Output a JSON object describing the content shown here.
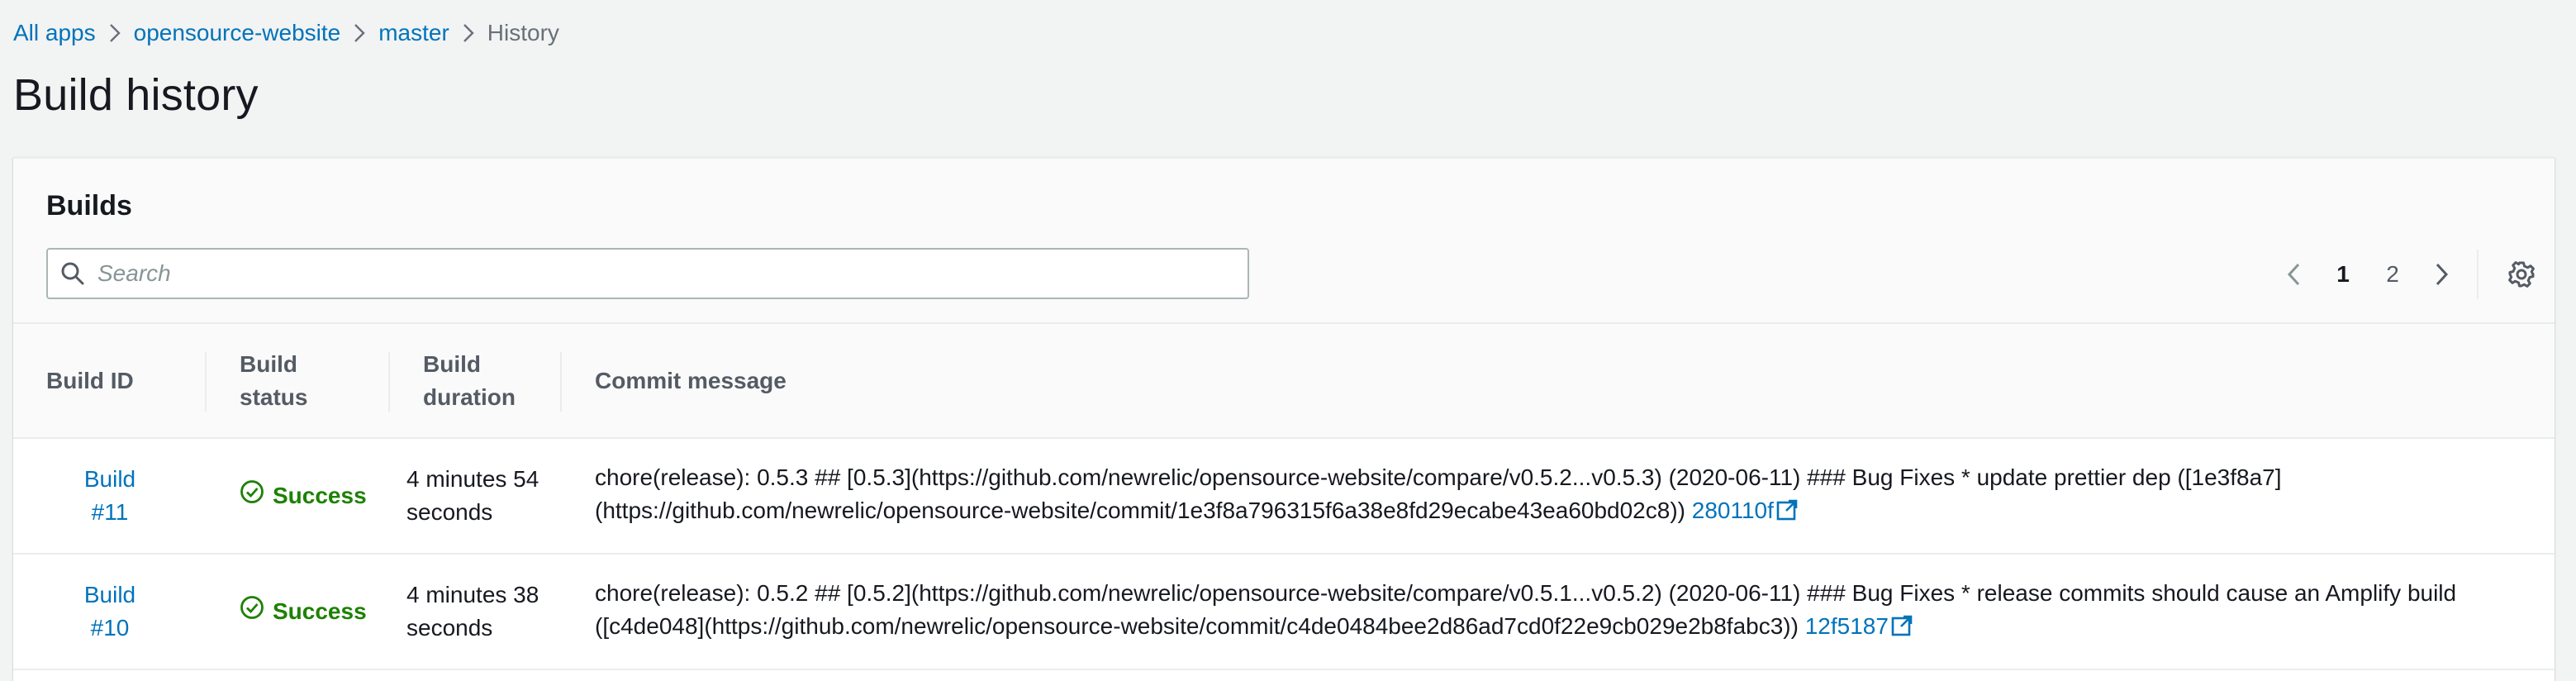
{
  "breadcrumb": {
    "items": [
      "All apps",
      "opensource-website",
      "master"
    ],
    "current": "History"
  },
  "page_title": "Build history",
  "builds_panel": {
    "title": "Builds",
    "search_placeholder": "Search",
    "pagination": {
      "pages": [
        "1",
        "2"
      ],
      "current_page": "1"
    }
  },
  "table": {
    "columns": [
      "Build ID",
      "Build status",
      "Build duration",
      "Commit message"
    ],
    "rows": [
      {
        "build_id": "Build #11",
        "status": "Success",
        "duration": "4 minutes 54 seconds",
        "commit_message": "chore(release): 0.5.3 ## [0.5.3](https://github.com/newrelic/opensource-website/compare/v0.5.2...v0.5.3) (2020-06-11) ### Bug Fixes * update prettier dep ([1e3f8a7](https://github.com/newrelic/opensource-website/commit/1e3f8a796315f6a38e8fd29ecabe43ea60bd02c8))",
        "commit_link": "280110f"
      },
      {
        "build_id": "Build #10",
        "status": "Success",
        "duration": "4 minutes 38 seconds",
        "commit_message": "chore(release): 0.5.2 ## [0.5.2](https://github.com/newrelic/opensource-website/compare/v0.5.1...v0.5.2) (2020-06-11) ### Bug Fixes * release commits should cause an Amplify build ([c4de048](https://github.com/newrelic/opensource-website/commit/c4de0484bee2d86ad7cd0f22e9cb029e2b8fabc3))",
        "commit_link": "12f5187"
      }
    ]
  },
  "colors": {
    "link": "#0073bb",
    "success": "#1d8102",
    "background": "#f2f3f3",
    "header_text": "#545b64"
  },
  "icons": [
    "chevron-right-icon",
    "search-icon",
    "chevron-left-icon",
    "settings-gear-icon",
    "check-circle-icon",
    "external-link-icon"
  ]
}
